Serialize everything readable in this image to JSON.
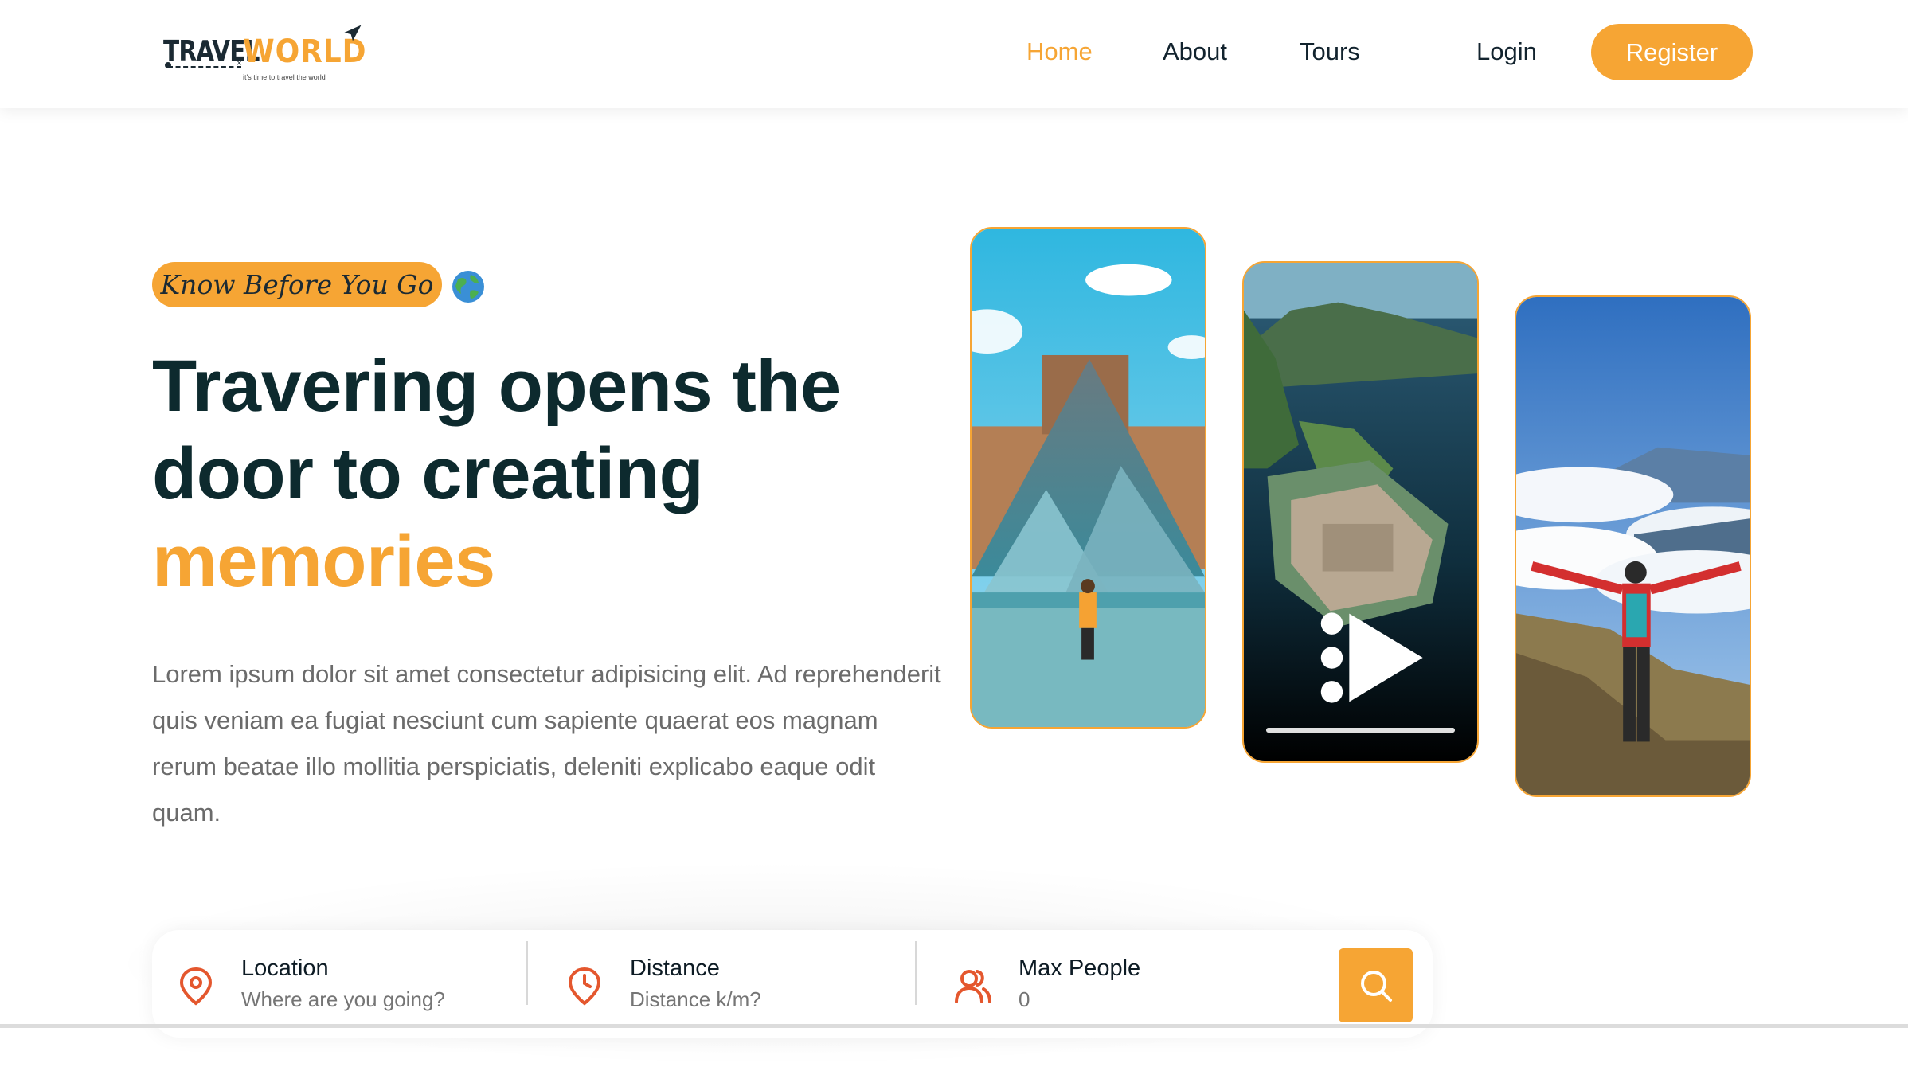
{
  "brand": {
    "name_part1": "TRAVEL",
    "name_part2": "WORLD",
    "tagline": "it's time to travel the world"
  },
  "nav": {
    "items": [
      {
        "label": "Home",
        "active": true
      },
      {
        "label": "About",
        "active": false
      },
      {
        "label": "Tours",
        "active": false
      }
    ],
    "login_label": "Login",
    "register_label": "Register"
  },
  "hero": {
    "badge": "Know Before You Go",
    "badge_icon": "globe-icon",
    "title_line1": "Travering opens the",
    "title_line2": "door to creating",
    "title_accent": "memories",
    "description": "Lorem ipsum dolor sit amet consectetur adipisicing elit. Ad reprehenderit quis veniam ea fugiat nesciunt cum sapiente quaerat eos magnam rerum beatae illo mollitia perspiciatis, deleniti explicabo eaque odit quam."
  },
  "media": {
    "video_progress": 1.0
  },
  "search": {
    "fields": [
      {
        "label": "Location",
        "placeholder": "Where are you going?",
        "icon": "map-pin-icon"
      },
      {
        "label": "Distance",
        "placeholder": "Distance k/m?",
        "icon": "clock-icon"
      },
      {
        "label": "Max People",
        "placeholder": "0",
        "icon": "users-icon"
      }
    ],
    "button_icon": "search-icon"
  },
  "colors": {
    "accent": "#f6a534",
    "heading": "#0d2a2e",
    "body_text": "#6b6b6b",
    "icon_red": "#e4572e"
  }
}
